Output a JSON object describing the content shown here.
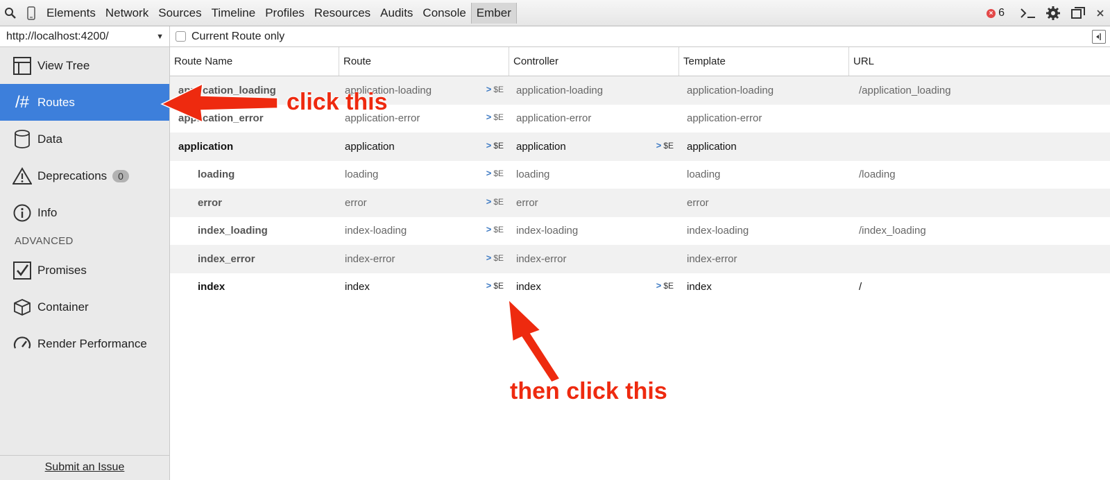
{
  "topbar": {
    "tabs": [
      "Elements",
      "Network",
      "Sources",
      "Timeline",
      "Profiles",
      "Resources",
      "Audits",
      "Console",
      "Ember"
    ],
    "active_tab": "Ember",
    "error_count": "6"
  },
  "sidebar": {
    "url": "http://localhost:4200/",
    "items": [
      {
        "label": "View Tree"
      },
      {
        "label": "Routes"
      },
      {
        "label": "Data"
      },
      {
        "label": "Deprecations",
        "badge": "0"
      },
      {
        "label": "Info"
      }
    ],
    "advanced_label": "ADVANCED",
    "advanced_items": [
      {
        "label": "Promises"
      },
      {
        "label": "Container"
      },
      {
        "label": "Render Performance"
      }
    ],
    "submit_label": "Submit an Issue"
  },
  "filter": {
    "label": "Current Route only"
  },
  "table": {
    "headers": [
      "Route Name",
      "Route",
      "Controller",
      "Template",
      "URL"
    ],
    "se_label": "$E",
    "rows": [
      {
        "name": "application_loading",
        "route": "application-loading",
        "controller": "application-loading",
        "template": "application-loading",
        "url": "/application_loading"
      },
      {
        "name": "application_error",
        "route": "application-error",
        "controller": "application-error",
        "template": "application-error",
        "url": ""
      },
      {
        "name": "application",
        "route": "application",
        "controller": "application",
        "template": "application",
        "url": ""
      },
      {
        "name": "loading",
        "route": "loading",
        "controller": "loading",
        "template": "loading",
        "url": "/loading"
      },
      {
        "name": "error",
        "route": "error",
        "controller": "error",
        "template": "error",
        "url": ""
      },
      {
        "name": "index_loading",
        "route": "index-loading",
        "controller": "index-loading",
        "template": "index-loading",
        "url": "/index_loading"
      },
      {
        "name": "index_error",
        "route": "index-error",
        "controller": "index-error",
        "template": "index-error",
        "url": ""
      },
      {
        "name": "index",
        "route": "index",
        "controller": "index",
        "template": "index",
        "url": "/"
      }
    ]
  },
  "annotations": {
    "first": "click this",
    "second": "then click this"
  },
  "colors": {
    "accent": "#3d7fdb",
    "annotation": "#ee2a0f",
    "error": "#e34848"
  }
}
